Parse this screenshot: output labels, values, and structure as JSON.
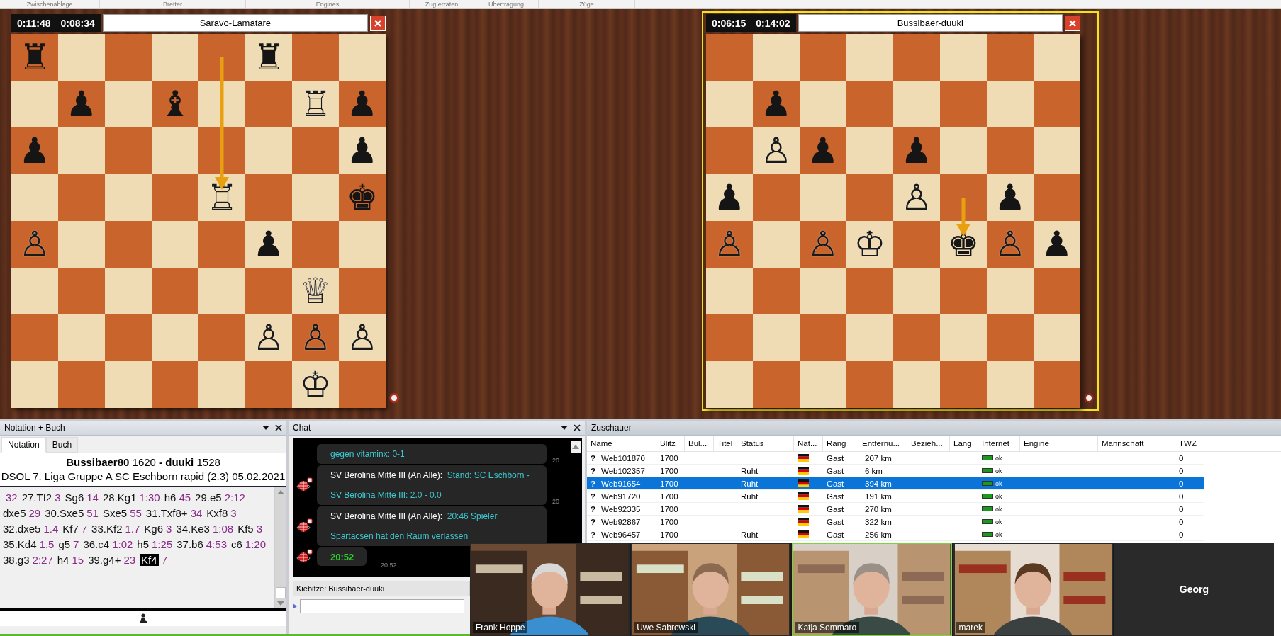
{
  "ribbon": {
    "groups": [
      "Zwischenablage",
      "Bretter",
      "Engines",
      "Zug erraten",
      "Übertragung",
      "Züge"
    ]
  },
  "boards": [
    {
      "clock_white": "0:11:48",
      "clock_black": "0:08:34",
      "title": "Saravo-Lamatare",
      "selected": false,
      "pieces": [
        "♜",
        "♜",
        "♟",
        "♝",
        "♖",
        "♟",
        "♟",
        "♟",
        "♖",
        "♚",
        "♙",
        "♟",
        "♕",
        "♙",
        "♙",
        "♙",
        "♔"
      ]
    },
    {
      "clock_white": "0:06:15",
      "clock_black": "0:14:02",
      "title": "Bussibaer-duuki",
      "selected": true,
      "pieces": [
        "♟",
        "♙",
        "♟",
        "♟",
        "♟",
        "♙",
        "♟",
        "♙",
        "♙",
        "♔",
        "♚",
        "♙",
        "♟"
      ]
    }
  ],
  "notation": {
    "panel_title": "Notation + Buch",
    "tabs": [
      {
        "label": "Notation",
        "selected": true
      },
      {
        "label": "Buch",
        "selected": false
      }
    ],
    "game_title": "**Bussibaer80** 1620 **- duuki** 1528",
    "event": "DSOL 7. Liga Gruppe A SC Eschborn rapid (2.3) 05.02.2021",
    "moves": [
      {
        "time": "32",
        "selected": false
      },
      {
        "move": "27.Tf2",
        "time": "3",
        "selected": false
      },
      {
        "move": "Sg6",
        "time": "14",
        "selected": false
      },
      {
        "move": "28.Kg1",
        "time": "1:30",
        "selected": false
      },
      {
        "move": "h6",
        "time": "45",
        "selected": false
      },
      {
        "move": "29.e5",
        "time": "2:12",
        "selected": false
      },
      {
        "move": "dxe5",
        "time": "29",
        "selected": false
      },
      {
        "move": "30.Sxe5",
        "time": "51",
        "selected": false
      },
      {
        "move": "Sxe5",
        "time": "55",
        "selected": false
      },
      {
        "move": "31.Txf8+",
        "time": "34",
        "selected": false
      },
      {
        "move": "Kxf8",
        "time": "3",
        "selected": false
      },
      {
        "move": "32.dxe5",
        "time": "1.4",
        "selected": false
      },
      {
        "move": "Kf7",
        "time": "7",
        "selected": false
      },
      {
        "move": "33.Kf2",
        "time": "1.7",
        "selected": false
      },
      {
        "move": "Kg6",
        "time": "3",
        "selected": false
      },
      {
        "move": "34.Ke3",
        "time": "1:08",
        "selected": false
      },
      {
        "move": "Kf5",
        "time": "3",
        "selected": false
      },
      {
        "move": "35.Kd4",
        "time": "1.5",
        "selected": false
      },
      {
        "move": "g5",
        "time": "7",
        "selected": false
      },
      {
        "move": "36.c4",
        "time": "1:02",
        "selected": false
      },
      {
        "move": "h5",
        "time": "1:25",
        "selected": false
      },
      {
        "move": "37.b6",
        "time": "4:53",
        "selected": false
      },
      {
        "move": "c6",
        "time": "1:20",
        "selected": false
      },
      {
        "move": "38.g3",
        "time": "2:27",
        "selected": false
      },
      {
        "move": "h4",
        "time": "15",
        "selected": false
      },
      {
        "move": "39.g4+",
        "time": "23",
        "selected": false
      },
      {
        "move": "Kf4",
        "time": "7",
        "selected": true
      }
    ]
  },
  "chat": {
    "panel_title": "Chat",
    "messages": [
      {
        "kind": "text",
        "text": "gegen vitaminx: 0-1",
        "time": "20"
      },
      {
        "kind": "announce",
        "sender": "SV Berolina Mitte III (An Alle):",
        "text": "Stand: SC Eschborn - SV Berolina Mitte III: 2.0 - 0.0",
        "time": "20"
      },
      {
        "kind": "announce",
        "sender": "SV Berolina Mitte III (An Alle):",
        "text": "20:46 Spieler Spartacsen hat den Raum verlassen"
      },
      {
        "kind": "clock",
        "text": "20:52",
        "time": "20:52"
      }
    ],
    "kibitz": "Kiebitze: Bussibaer-duuki"
  },
  "spectators": {
    "panel_title": "Zuschauer",
    "columns": [
      "Name",
      "Blitz",
      "Bul...",
      "Titel",
      "Status",
      "Nat...",
      "Rang",
      "Entfernu...",
      "Bezieh...",
      "Lang",
      "Internet",
      "Engine",
      "Mannschaft",
      "TWZ"
    ],
    "rows": [
      {
        "mark": "?",
        "name": "Web101870",
        "blitz": "1700",
        "rang": "Gast",
        "distance": "207 km",
        "internet": "ok",
        "twz": "0",
        "selected": false
      },
      {
        "mark": "?",
        "name": "Web102357",
        "blitz": "1700",
        "status": "Ruht",
        "rang": "Gast",
        "distance": "6 km",
        "internet": "ok",
        "twz": "0",
        "selected": false
      },
      {
        "mark": "?",
        "name": "Web91654",
        "blitz": "1700",
        "status": "Ruht",
        "rang": "Gast",
        "distance": "394 km",
        "internet": "ok",
        "twz": "0",
        "selected": true
      },
      {
        "mark": "?",
        "name": "Web91720",
        "blitz": "1700",
        "status": "Ruht",
        "rang": "Gast",
        "distance": "191 km",
        "internet": "ok",
        "twz": "0",
        "selected": false
      },
      {
        "mark": "?",
        "name": "Web92335",
        "blitz": "1700",
        "rang": "Gast",
        "distance": "270 km",
        "internet": "ok",
        "twz": "0",
        "selected": false
      },
      {
        "mark": "?",
        "name": "Web92867",
        "blitz": "1700",
        "rang": "Gast",
        "distance": "322 km",
        "internet": "ok",
        "twz": "0",
        "selected": false
      },
      {
        "mark": "?",
        "name": "Web96457",
        "blitz": "1700",
        "status": "Ruht",
        "rang": "Gast",
        "distance": "256 km",
        "internet": "ok",
        "twz": "0",
        "selected": false
      }
    ]
  },
  "video_call": {
    "tiles": [
      {
        "kind": "video",
        "name": "Frank Hoppe",
        "speaking": false
      },
      {
        "kind": "video",
        "name": "Uwe Sabrowski",
        "speaking": false
      },
      {
        "kind": "video",
        "name": "Katja Sommaro",
        "speaking": true
      },
      {
        "kind": "video",
        "name": "marek",
        "speaking": false
      },
      {
        "kind": "name_only",
        "name": "Georg",
        "speaking": false
      }
    ]
  }
}
